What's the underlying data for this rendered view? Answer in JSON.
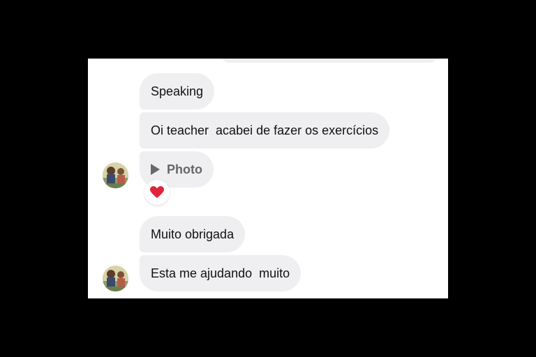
{
  "messages": [
    {
      "text": "Speaking"
    },
    {
      "text": "Oi teacher  acabei de fazer os exercícios"
    },
    {
      "label": "Photo",
      "icon": "play-icon"
    },
    {
      "text": "Muito obrigada"
    },
    {
      "text": "Esta me ajudando  muito"
    }
  ],
  "reaction": {
    "icon": "heart-icon",
    "color": "#e0243b"
  },
  "colors": {
    "bubble": "#efeff1",
    "text": "#111111",
    "secondary": "#65676b",
    "background": "#ffffff",
    "frame": "#000000"
  }
}
